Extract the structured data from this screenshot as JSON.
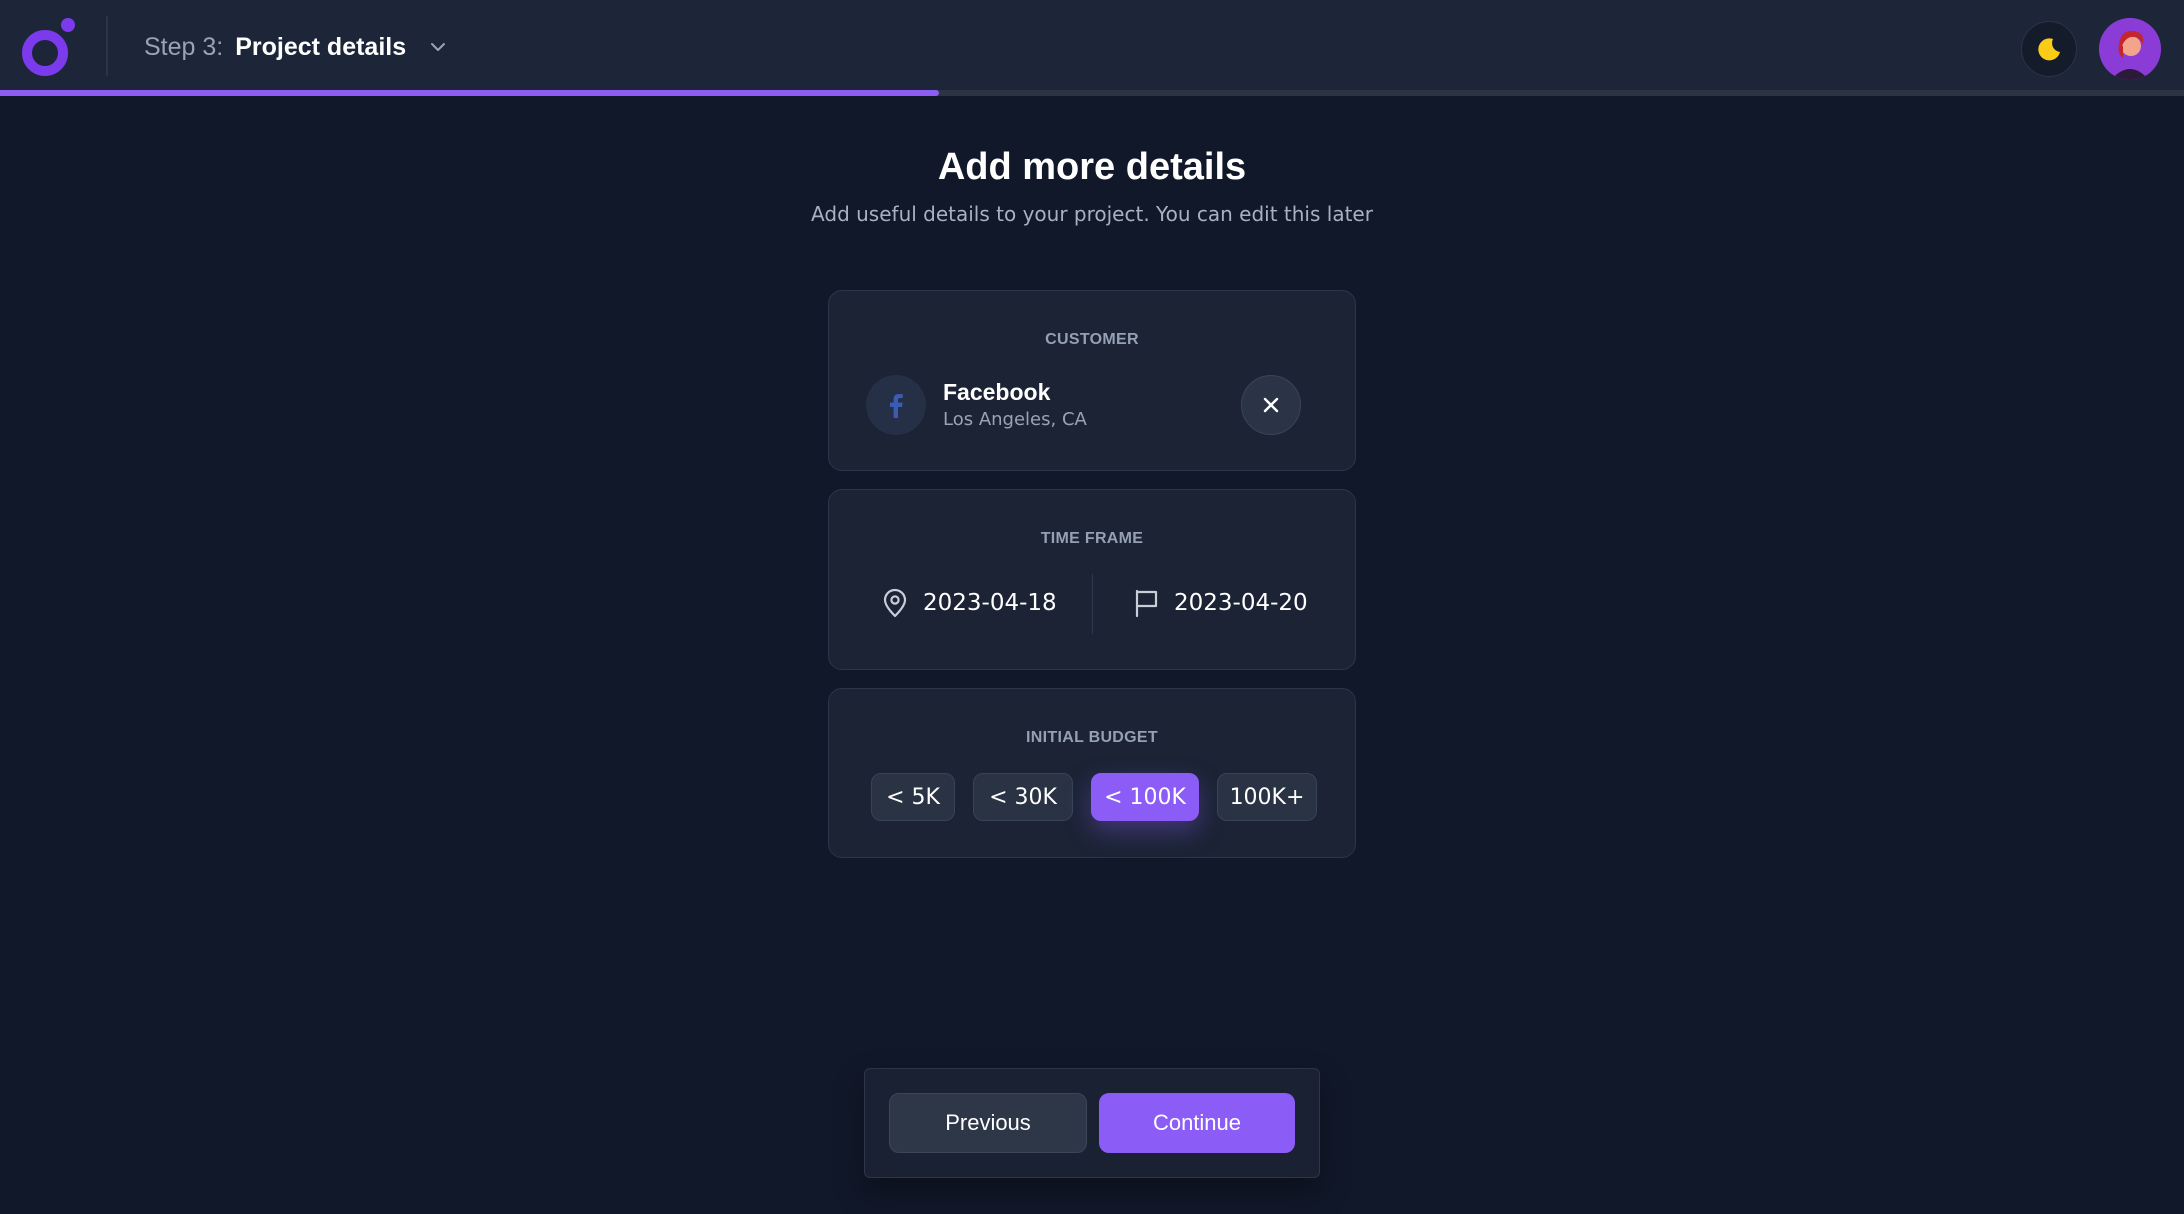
{
  "header": {
    "step_prefix": "Step 3:",
    "step_title": "Project details",
    "progress": 0.43
  },
  "page": {
    "title": "Add more details",
    "subtitle": "Add useful details to your project. You can edit this later"
  },
  "customer": {
    "label": "CUSTOMER",
    "name": "Facebook",
    "location": "Los Angeles, CA",
    "icon": "facebook-icon"
  },
  "timeframe": {
    "label": "TIME FRAME",
    "start_date": "2023-04-18",
    "end_date": "2023-04-20",
    "start_icon": "map-pin-icon",
    "end_icon": "flag-icon"
  },
  "budget": {
    "label": "INITIAL BUDGET",
    "options": [
      "< 5K",
      "< 30K",
      "< 100K",
      "100K+"
    ],
    "selected": "< 100K"
  },
  "footer": {
    "previous_label": "Previous",
    "continue_label": "Continue"
  },
  "colors": {
    "accent": "#8b5cf6",
    "background": "#111829",
    "topbar": "#1d2638",
    "moon": "#facc15"
  }
}
